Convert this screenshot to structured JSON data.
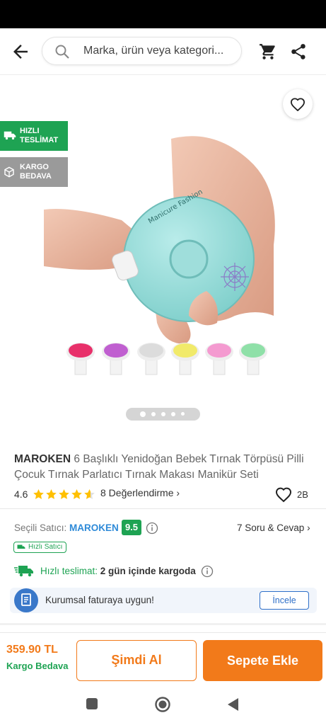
{
  "search": {
    "placeholder": "Marka, ürün veya kategori..."
  },
  "badges": {
    "fast_delivery": "HIZLI\nTESLİMAT",
    "free_shipping": "KARGO\nBEDAVA"
  },
  "product": {
    "brand": "MAROKEN",
    "name": "6 Başlıklı Yenidoğan Bebek Tırnak Törpüsü Pilli Çocuk Tırnak Parlatıcı Tırnak Makası Manikür Seti",
    "device_print": "Manicure Fashion",
    "rating": "4.6",
    "rating_value": 4.6,
    "reviews_label": "8 Değerlendirme",
    "likes": "2B",
    "image_count": 5,
    "active_image": 1
  },
  "seller": {
    "label": "Seçili Satıcı:",
    "name": "MAROKEN",
    "score": "9.5",
    "qa_label": "7 Soru & Cevap",
    "fast_seller_tag": "Hızlı Satıcı"
  },
  "delivery": {
    "label": "Hızlı teslimat:",
    "value": "2 gün içinde kargoda"
  },
  "corporate": {
    "text": "Kurumsal faturaya uygun!",
    "button": "İncele"
  },
  "purchase": {
    "price": "359.90 TL",
    "shipping": "Kargo Bedava",
    "buy_now": "Şimdi Al",
    "add_to_cart": "Sepete Ekle"
  },
  "colors": {
    "accent": "#f27a1a",
    "green": "#1ea353",
    "blue": "#2e8ad8"
  }
}
